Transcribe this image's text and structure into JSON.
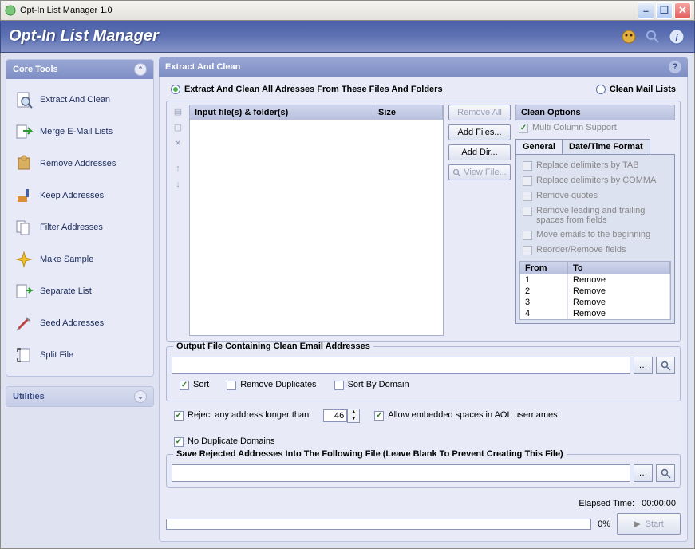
{
  "window": {
    "title": "Opt-In List Manager 1.0"
  },
  "header": {
    "app_title": "Opt-In List Manager"
  },
  "sidebar": {
    "core_tools_title": "Core Tools",
    "utilities_title": "Utilities",
    "items": [
      {
        "label": "Extract And Clean"
      },
      {
        "label": "Merge E-Mail Lists"
      },
      {
        "label": "Remove Addresses"
      },
      {
        "label": "Keep Addresses"
      },
      {
        "label": "Filter Addresses"
      },
      {
        "label": "Make Sample"
      },
      {
        "label": "Separate List"
      },
      {
        "label": "Seed Addresses"
      },
      {
        "label": "Split File"
      }
    ]
  },
  "content": {
    "title": "Extract And Clean",
    "radio_extract": "Extract And Clean All Adresses From These Files And Folders",
    "radio_clean": "Clean Mail Lists",
    "table": {
      "col1": "Input file(s) & folder(s)",
      "col2": "Size"
    },
    "buttons": {
      "remove_all": "Remove All",
      "add_files": "Add Files...",
      "add_dir": "Add Dir...",
      "view_file": "View File..."
    },
    "clean": {
      "title": "Clean Options",
      "multi_column": "Multi Column Support",
      "tab_general": "General",
      "tab_datetime": "Date/Time Format",
      "opts": [
        "Replace delimiters by TAB",
        "Replace delimiters by COMMA",
        "Remove quotes",
        "Remove leading and trailing spaces from fields",
        "Move emails to the beginning",
        "Reorder/Remove fields"
      ],
      "mini_cols": {
        "c1": "From",
        "c2": "To"
      },
      "mini_rows": [
        {
          "from": "1",
          "to": "Remove"
        },
        {
          "from": "2",
          "to": "Remove"
        },
        {
          "from": "3",
          "to": "Remove"
        },
        {
          "from": "4",
          "to": "Remove"
        }
      ]
    },
    "output": {
      "legend": "Output File Containing Clean Email Addresses",
      "sort": "Sort",
      "remove_dup": "Remove Duplicates",
      "sort_domain": "Sort By Domain"
    },
    "opts_row": {
      "reject_longer": "Reject any address longer than",
      "reject_value": "46",
      "allow_embedded": "Allow embedded spaces in AOL usernames",
      "no_dup_domains": "No Duplicate Domains"
    },
    "rejected": {
      "legend": "Save Rejected Addresses Into The Following File (Leave Blank To Prevent Creating This File)"
    },
    "footer": {
      "elapsed_label": "Elapsed Time:",
      "elapsed_value": "00:00:00",
      "progress": "0%",
      "start": "Start"
    }
  }
}
